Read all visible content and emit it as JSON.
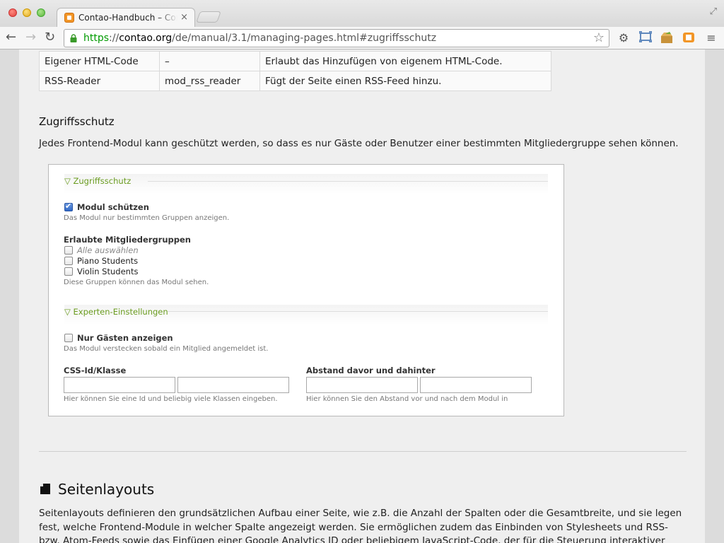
{
  "browser": {
    "tab_title": "Contao-Handbuch – Contao",
    "tab_close": "×",
    "url_scheme": "https",
    "url_sep": "://",
    "url_host": "contao.org",
    "url_path": "/de/manual/3.1/managing-pages.html#zugriffsschutz"
  },
  "modules_table": {
    "rows": [
      [
        "Eigener HTML-Code",
        "–",
        "Erlaubt das Hinzufügen von eigenem HTML-Code."
      ],
      [
        "RSS-Reader",
        "mod_rss_reader",
        "Fügt der Seite einen RSS-Feed hinzu."
      ]
    ]
  },
  "section": {
    "title": "Zugriffsschutz",
    "lead": "Jedes Frontend-Modul kann geschützt werden, so dass es nur Gäste oder Benutzer einer bestimmten Mitgliedergruppe sehen können."
  },
  "form": {
    "legend_protect": "▽ Zugriffsschutz",
    "protect_label": "Modul schützen",
    "protect_checked": true,
    "protect_help": "Das Modul nur bestimmten Gruppen anzeigen.",
    "groups_label": "Erlaubte Mitgliedergruppen",
    "groups": [
      "Alle auswählen",
      "Piano Students",
      "Violin Students"
    ],
    "groups_help": "Diese Gruppen können das Modul sehen.",
    "legend_expert": "▽ Experten-Einstellungen",
    "guests_label": "Nur Gästen anzeigen",
    "guests_help": "Das Modul verstecken sobald ein Mitglied angemeldet ist.",
    "css_label": "CSS-Id/Klasse",
    "css_help": "Hier können Sie eine Id und beliebig viele Klassen eingeben.",
    "space_label": "Abstand davor und dahinter",
    "space_help": "Hier können Sie den Abstand vor und nach dem Modul in"
  },
  "layouts": {
    "title": "Seitenlayouts",
    "body": "Seitenlayouts definieren den grundsätzlichen Aufbau einer Seite, wie z.B. die Anzahl der Spalten oder die Gesamtbreite, und sie legen fest, welche Frontend-Module in welcher Spalte angezeigt werden. Sie ermöglichen zudem das Einbinden von Stylesheets und RSS- bzw. Atom-Feeds sowie das Einfügen einer Google Analytics ID oder beliebigem JavaScript-Code, der für die Steuerung interaktiver Elemente und Plugins benötigt"
  },
  "colors": {
    "legend_green": "#6a9c1f",
    "url_green": "#009a00",
    "favicon_orange": "#f29627"
  }
}
